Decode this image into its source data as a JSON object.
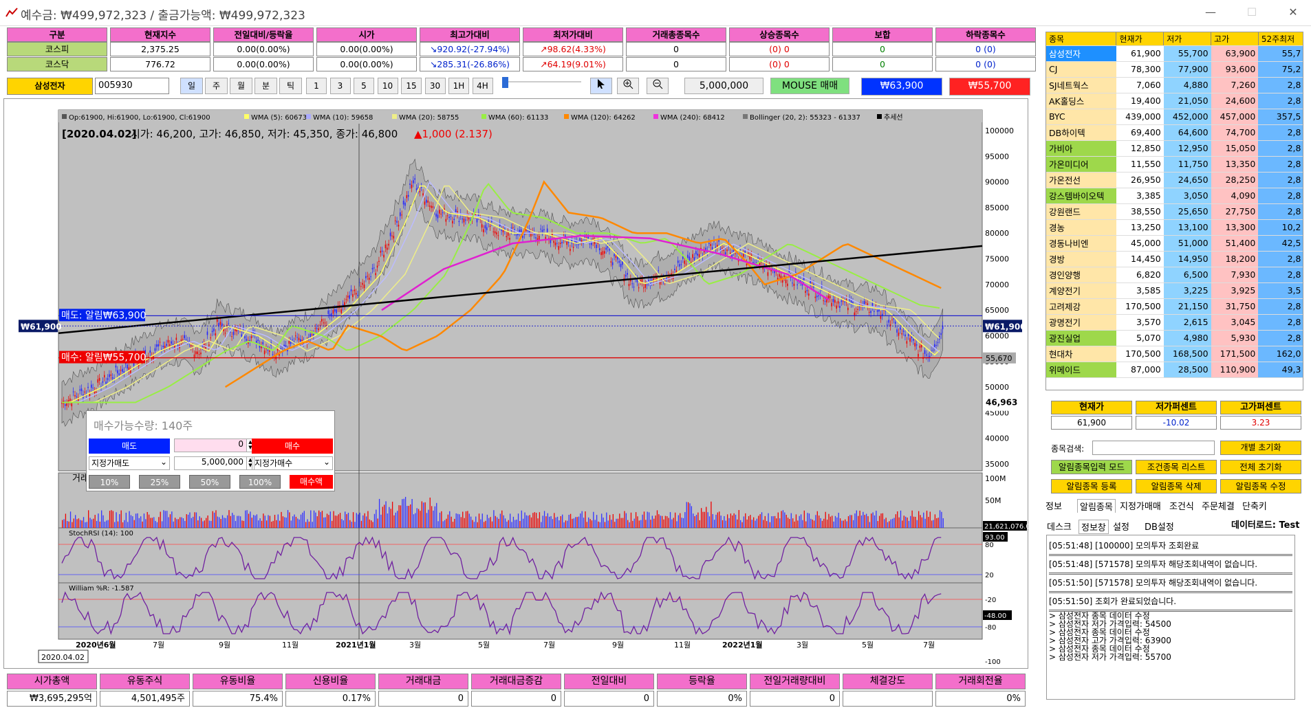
{
  "window": {
    "title": "예수금: ₩499,972,323 / 출금가능액: ₩499,972,323"
  },
  "market": {
    "headers": [
      "구분",
      "현재지수",
      "전일대비/등락율",
      "시가",
      "최고가대비",
      "최저가대비",
      "거래총종목수",
      "상승종목수",
      "보합",
      "하락종목수"
    ],
    "rows": [
      {
        "name": "코스피",
        "index": "2,375.25",
        "change": "0.00(0.00%)",
        "open": "0.00(0.00%)",
        "high": "↘920.92(-27.94%)",
        "low": "↗98.62(4.33%)",
        "total": "0",
        "up": "(0) 0",
        "flat": "0",
        "down": "0 (0)"
      },
      {
        "name": "코스닥",
        "index": "776.72",
        "change": "0.00(0.00%)",
        "open": "0.00(0.00%)",
        "high": "↘285.31(-26.86%)",
        "low": "↗64.19(9.01%)",
        "total": "0",
        "up": "(0) 0",
        "flat": "0",
        "down": "0 (0)"
      }
    ]
  },
  "toolbar": {
    "stock_name": "삼성전자",
    "code": "005930",
    "periods": [
      "일",
      "주",
      "월",
      "분",
      "틱"
    ],
    "intervals": [
      "1",
      "3",
      "5",
      "10",
      "15",
      "30",
      "1H",
      "4H"
    ],
    "amount": "5,000,000",
    "mouse_label": "MOUSE 매매",
    "sell_price": "₩63,900",
    "buy_price": "₩55,700"
  },
  "chart": {
    "legend": [
      "Op:61900, Hi:61900, Lo:61900, Cl:61900",
      "WMA (5): 60673",
      "WMA (10): 59658",
      "WMA (20): 58755",
      "WMA (60): 61133",
      "WMA (120): 64262",
      "WMA (240): 68412",
      "Bollinger (20, 2): 55323 - 61337",
      "추세선"
    ],
    "info_date": "[2020.04.02]",
    "info_text": "시가: 46,200, 고가: 46,850, 저가: 45,350, 종가: 46,800",
    "info_change": "▲1,000 (2.137)",
    "y_ticks": [
      "100000",
      "95000",
      "90000",
      "85000",
      "80000",
      "75000",
      "70000",
      "65000",
      "60000",
      "55000",
      "50000",
      "45000",
      "40000",
      "35000"
    ],
    "sell_alert": "매도: 알림₩63,900",
    "buy_alert": "매수: 알림₩55,700",
    "current_tag": "₩61,900",
    "right_tag": "₩61,900",
    "low_tag": "55,670",
    "hover_tag": "46,963",
    "volume_label": "거래량",
    "volume_ticks": [
      "100M",
      "50M"
    ],
    "volume_tag": "21,621,076.00",
    "stoch_label": "StochRSI (14): 100",
    "stoch_ticks": [
      "80",
      "20"
    ],
    "stoch_tag": "93.00",
    "will_label": "William %R: -1.587",
    "will_ticks": [
      "-20",
      "-80",
      "-100"
    ],
    "will_tag": "-48.00",
    "x_ticks": [
      "2020년6월",
      "7월",
      "9월",
      "11월",
      "2021년1월",
      "3월",
      "5월",
      "7월",
      "9월",
      "11월",
      "2022년1월",
      "3월",
      "5월",
      "7월"
    ],
    "date_tag": "2020.04.02"
  },
  "order": {
    "title": "매수가능수량: 140주",
    "sell": "매도",
    "buy": "매수",
    "qty": "0",
    "sell_type": "지정가매도",
    "amount": "5,000,000",
    "buy_type": "지정가매수",
    "pcts": [
      "10%",
      "25%",
      "50%",
      "100%"
    ],
    "amount_btn": "매수액"
  },
  "stock_table": {
    "headers": [
      "종목",
      "현재가",
      "저가",
      "고가",
      "52주최저"
    ],
    "rows": [
      [
        "삼성전자",
        "61,900",
        "55,700",
        "63,900",
        "55,7"
      ],
      [
        "CJ",
        "78,300",
        "77,900",
        "93,600",
        "75,2"
      ],
      [
        "SJ네트웍스",
        "7,060",
        "4,880",
        "7,260",
        "2,8"
      ],
      [
        "AK홀딩스",
        "19,400",
        "21,050",
        "24,600",
        "2,8"
      ],
      [
        "BYC",
        "439,000",
        "452,000",
        "457,000",
        "357,5"
      ],
      [
        "DB하이텍",
        "69,400",
        "64,600",
        "74,700",
        "2,8"
      ],
      [
        "가비아",
        "12,850",
        "12,950",
        "15,050",
        "2,8"
      ],
      [
        "가온미디어",
        "11,550",
        "11,750",
        "13,350",
        "2,8"
      ],
      [
        "가온전선",
        "26,950",
        "24,650",
        "28,250",
        "2,8"
      ],
      [
        "강스템바이오텍",
        "3,385",
        "3,050",
        "4,090",
        "2,8"
      ],
      [
        "강원랜드",
        "38,550",
        "25,650",
        "27,750",
        "2,8"
      ],
      [
        "경농",
        "13,250",
        "13,100",
        "13,300",
        "10,2"
      ],
      [
        "경동나비엔",
        "45,000",
        "51,000",
        "51,400",
        "42,5"
      ],
      [
        "경방",
        "14,450",
        "14,950",
        "18,200",
        "2,8"
      ],
      [
        "경인양행",
        "6,820",
        "6,500",
        "7,930",
        "2,8"
      ],
      [
        "계양전기",
        "3,585",
        "3,225",
        "3,925",
        "3,5"
      ],
      [
        "고려제강",
        "170,500",
        "21,150",
        "31,750",
        "2,8"
      ],
      [
        "광명전기",
        "3,570",
        "2,615",
        "3,045",
        "2,8"
      ],
      [
        "광진실업",
        "5,070",
        "4,980",
        "5,930",
        "2,8"
      ],
      [
        "현대차",
        "170,500",
        "168,500",
        "171,500",
        "162,0"
      ],
      [
        "위메이드",
        "87,000",
        "28,500",
        "110,900",
        "49,3"
      ]
    ]
  },
  "summary": {
    "h_current": "현재가",
    "h_low_pct": "저가퍼센트",
    "h_high_pct": "고가퍼센트",
    "current": "61,900",
    "low_pct": "-10.02",
    "high_pct": "3.23"
  },
  "controls": {
    "search_label": "종목검색:",
    "reset_one": "개별 초기화",
    "alert_input": "알림종목입력 모드",
    "cond_list": "조건종목 리스트",
    "reset_all": "전체 초기화",
    "alert_reg": "알림종목 등록",
    "alert_del": "알림종목 삭제",
    "alert_edit": "알림종목 수정"
  },
  "tabs1": [
    "정보",
    "알림종목",
    "지정가매매",
    "조건식",
    "주문체결",
    "단축키"
  ],
  "tabs2": [
    "데스크",
    "정보창",
    "설정",
    "DB설정"
  ],
  "data_road": "데이터로드: Test",
  "log": [
    "[05:51:48] [100000] 모의투자 조회완료",
    "[05:51:48] [571578] 모의투자 해당조회내역이 없습니다.",
    "[05:51:50] [571578] 모의투자 해당조회내역이 없습니다.",
    "[05:51:50] 조회가 완료되었습니다.",
    "> 삼성전자 종목 데이터 수정",
    "> 삼성전자 저가 가격입력: 54500",
    "> 삼성전자 종목 데이터 수정",
    "> 삼성전자 고가 가격입력: 63900",
    "> 삼성전자 종목 데이터 수정",
    "> 삼성전자 저가 가격입력: 55700"
  ],
  "bottom": {
    "headers": [
      "시가총액",
      "유동주식",
      "유동비율",
      "신용비율",
      "거래대금",
      "거래대금증감",
      "전일대비",
      "등락율",
      "전일거래량대비",
      "체결강도",
      "거래회전율"
    ],
    "values": [
      "₩3,695,295억",
      "4,501,495주",
      "75.4%",
      "0.17%",
      "0",
      "0",
      "0",
      "0%",
      "0",
      "",
      ""
    ],
    "last": "0%"
  }
}
